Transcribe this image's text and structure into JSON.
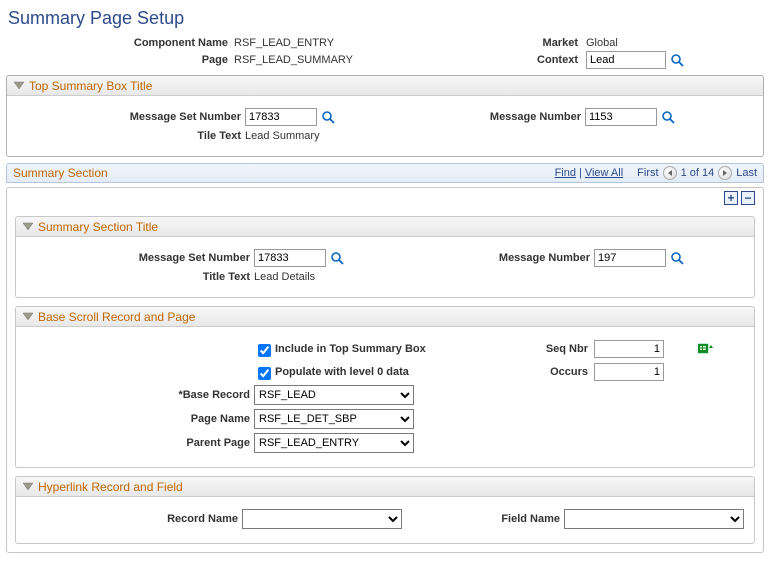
{
  "page_title": "Summary Page Setup",
  "header": {
    "component_label": "Component Name",
    "component_value": "RSF_LEAD_ENTRY",
    "page_label": "Page",
    "page_value": "RSF_LEAD_SUMMARY",
    "market_label": "Market",
    "market_value": "Global",
    "context_label": "Context",
    "context_value": "Lead"
  },
  "top_box": {
    "section_title": "Top Summary Box Title",
    "msg_set_label": "Message Set Number",
    "msg_set_value": "17833",
    "msg_num_label": "Message Number",
    "msg_num_value": "1153",
    "tile_text_label": "Tile Text",
    "tile_text_value": "Lead Summary"
  },
  "summary_scroll": {
    "title": "Summary Section",
    "find": "Find",
    "view_all": "View All",
    "first": "First",
    "counter": "1 of 14",
    "last": "Last"
  },
  "sec_title": {
    "section_title": "Summary Section Title",
    "msg_set_label": "Message Set Number",
    "msg_set_value": "17833",
    "msg_num_label": "Message Number",
    "msg_num_value": "197",
    "title_text_label": "Title Text",
    "title_text_value": "Lead Details"
  },
  "base": {
    "section_title": "Base Scroll Record and Page",
    "include_label": "Include in Top Summary Box",
    "populate_label": "Populate with level 0 data",
    "base_record_label": "*Base Record",
    "base_record_value": "RSF_LEAD",
    "page_name_label": "Page Name",
    "page_name_value": "RSF_LE_DET_SBP",
    "parent_page_label": "Parent Page",
    "parent_page_value": "RSF_LEAD_ENTRY",
    "seq_label": "Seq Nbr",
    "seq_value": "1",
    "occurs_label": "Occurs",
    "occurs_value": "1"
  },
  "hyperlink": {
    "section_title": "Hyperlink Record and Field",
    "record_label": "Record Name",
    "field_label": "Field Name"
  }
}
